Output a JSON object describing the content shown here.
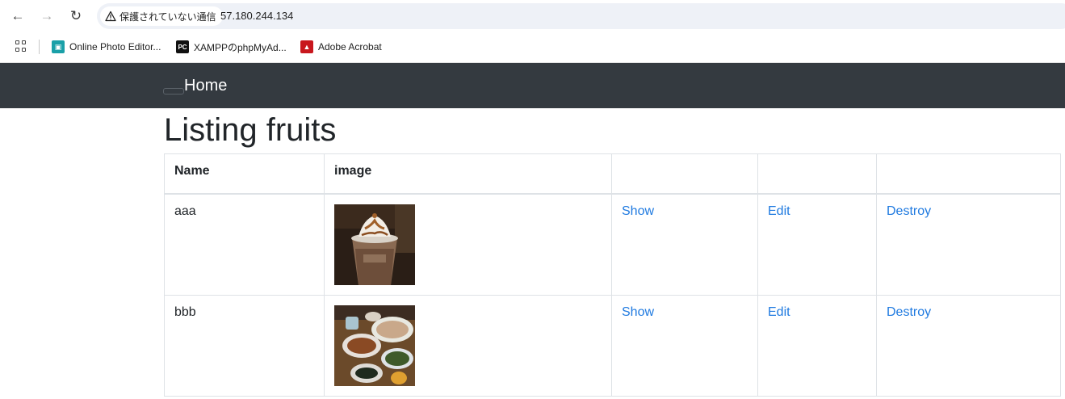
{
  "browser": {
    "security_label": "保護されていない通信",
    "url": "57.180.244.134",
    "bookmarks": [
      {
        "label": "Online Photo Editor...",
        "icon": "photo-editor-favicon"
      },
      {
        "label": "XAMPPのphpMyAd...",
        "icon": "phpmyadmin-favicon",
        "icon_text": "PC"
      },
      {
        "label": "Adobe Acrobat",
        "icon": "acrobat-favicon"
      }
    ]
  },
  "navbar": {
    "brand": "Home"
  },
  "page": {
    "title": "Listing fruits",
    "table": {
      "headers": [
        "Name",
        "image",
        "",
        "",
        ""
      ],
      "rows": [
        {
          "name": "aaa",
          "image": "frappe-drink-photo",
          "show": "Show",
          "edit": "Edit",
          "destroy": "Destroy"
        },
        {
          "name": "bbb",
          "image": "dinner-table-photo",
          "show": "Show",
          "edit": "Edit",
          "destroy": "Destroy"
        }
      ]
    }
  },
  "colors": {
    "navbar_bg": "#343a40",
    "link": "#1f7ae0",
    "border": "#dee2e6"
  }
}
